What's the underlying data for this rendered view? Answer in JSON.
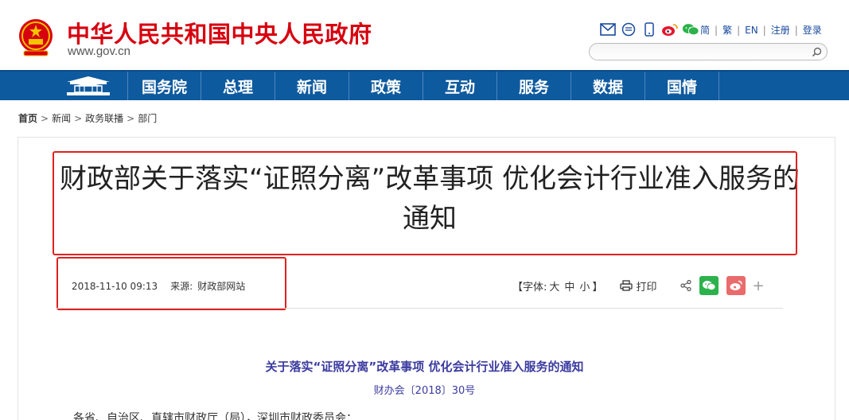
{
  "header": {
    "site_title": "中华人民共和国中央人民政府",
    "site_domain": "www.gov.cn",
    "icons": [
      "mail-icon",
      "chat-icon",
      "mobile-icon",
      "weibo-icon",
      "wechat-icon"
    ],
    "links": [
      "简",
      "繁",
      "EN",
      "注册",
      "登录"
    ],
    "search_placeholder": ""
  },
  "nav": {
    "items": [
      "国务院",
      "总理",
      "新闻",
      "政策",
      "互动",
      "服务",
      "数据",
      "国情"
    ]
  },
  "breadcrumb": [
    "首页",
    "新闻",
    "政务联播",
    "部门"
  ],
  "article": {
    "title": "财政部关于落实“证照分离”改革事项 优化会计行业准入服务的通知",
    "date": "2018-11-10 09:13",
    "source_label": "来源:",
    "source": "财政部网站",
    "font_label": "【字体:",
    "font_sizes": [
      "大",
      "中",
      "小"
    ],
    "font_end": "】",
    "print_label": "打印",
    "plus": "+",
    "sub_title": "关于落实“证照分离”改革事项 优化会计行业准入服务的通知",
    "doc_no": "财办会〔2018〕30号",
    "body_first_line": "各省、自治区、直辖市财政厅（局），深圳市财政委员会："
  },
  "colors": {
    "brand_red": "#d7000f",
    "nav_blue": "#0e5a9f",
    "highlight_red": "#e02020",
    "subtitle_blue": "#3b3ba0"
  }
}
